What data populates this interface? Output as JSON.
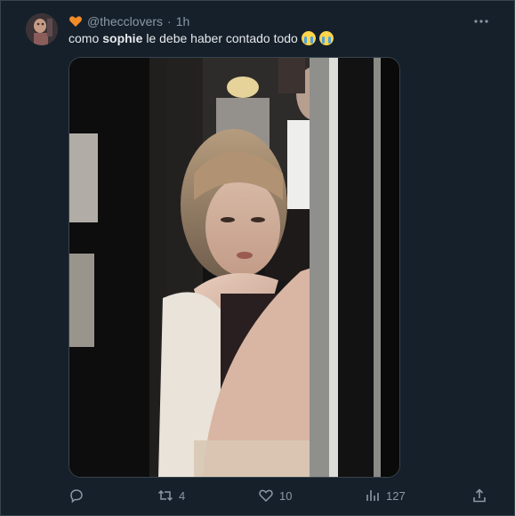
{
  "tweet": {
    "handle": "@thecclovers",
    "separator": "·",
    "time": "1h",
    "text_before": "como",
    "text_bold": "sophie",
    "text_after": "le debe haber contado todo"
  },
  "actions": {
    "reply_count": "",
    "retweet_count": "4",
    "like_count": "10",
    "view_count": "127"
  },
  "icons": {
    "profile": "heart-icon",
    "more": "more-icon",
    "reply": "reply-icon",
    "retweet": "retweet-icon",
    "like": "like-icon",
    "views": "views-icon",
    "share": "share-icon",
    "emoji": "loudly-crying-face-emoji"
  },
  "colors": {
    "background": "#15202b",
    "text": "#e7e9ea",
    "muted": "#8b98a5",
    "heart": "#f28c28"
  }
}
